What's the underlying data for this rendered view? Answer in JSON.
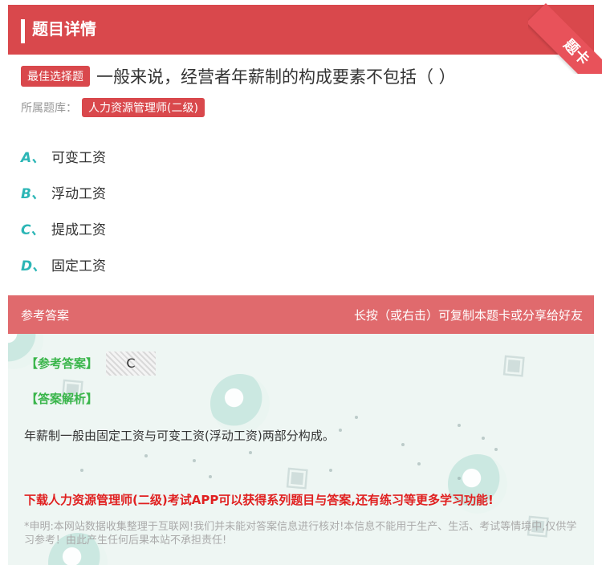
{
  "header": {
    "title": "题目详情",
    "ribbon": "题卡"
  },
  "question": {
    "type_badge": "最佳选择题",
    "text": "一般来说，经营者年薪制的构成要素不包括（ ）",
    "library_label": "所属题库：",
    "library_name": "人力资源管理师(二级)"
  },
  "options": [
    {
      "letter": "A、",
      "text": "可变工资"
    },
    {
      "letter": "B、",
      "text": "浮动工资"
    },
    {
      "letter": "C、",
      "text": "提成工资"
    },
    {
      "letter": "D、",
      "text": "固定工资"
    }
  ],
  "answer_section": {
    "title": "参考答案",
    "hint": "长按（或右击）可复制本题卡或分享给好友",
    "answer_label": "【参考答案】",
    "answer_value": "C",
    "analysis_label": "【答案解析】",
    "analysis_text": "年薪制一般由固定工资与可变工资(浮动工资)两部分构成。",
    "promo": "下载人力资源管理师(二级)考试APP可以获得系列题目与答案,还有练习等更多学习功能!",
    "disclaimer": "*申明:本网站数据收集整理于互联网!我们并未能对答案信息进行核对!本信息不能用于生产、生活、考试等情境中,仅供学习参考！由此产生任何后果本站不承担责任!"
  },
  "colors": {
    "brand_red": "#d9484c",
    "option_letter": "#2cb6b6",
    "answer_green": "#39b54a",
    "promo_red": "#e02020"
  }
}
